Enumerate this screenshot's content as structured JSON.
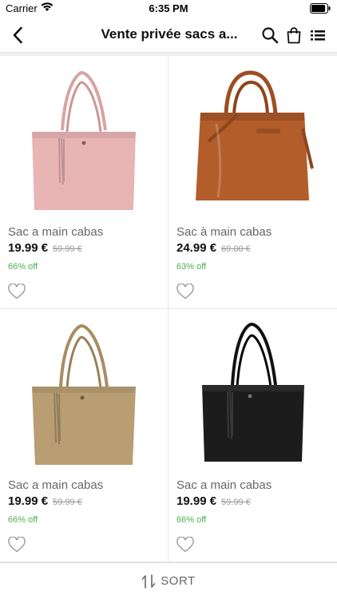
{
  "status_bar": {
    "carrier": "Carrier",
    "time": "6:35 PM",
    "battery_level": 0.9
  },
  "header": {
    "title": "Vente privée sacs a...",
    "icons": [
      "back-chevron",
      "search",
      "shopping-bag",
      "list-menu"
    ]
  },
  "products": [
    {
      "name": "Sac a main cabas",
      "price": "19.99 €",
      "old_price": "59.99 €",
      "discount": "66% off",
      "bag_color": "#e8b4b4"
    },
    {
      "name": "Sac à main cabas",
      "price": "24.99 €",
      "old_price": "69.00 €",
      "discount": "63% off",
      "bag_color": "#b35d2a"
    },
    {
      "name": "Sac a main cabas",
      "price": "19.99 €",
      "old_price": "59.99 €",
      "discount": "66% off",
      "bag_color": "#b89e72"
    },
    {
      "name": "Sac a main cabas",
      "price": "19.99 €",
      "old_price": "59.99 €",
      "discount": "66% off",
      "bag_color": "#1c1c1c"
    }
  ],
  "sort": {
    "label": "SORT"
  },
  "colors": {
    "discount": "#4caf50",
    "border": "#e6e6e6",
    "muted_text": "#666666"
  }
}
